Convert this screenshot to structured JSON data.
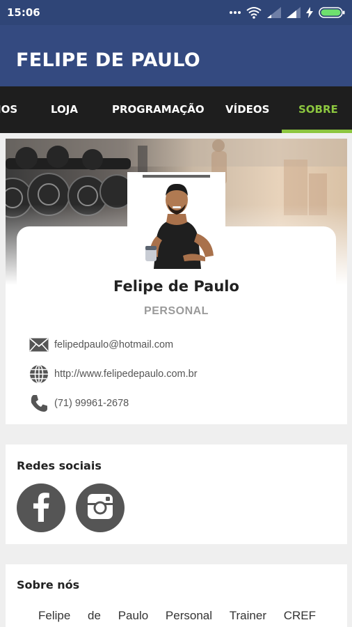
{
  "status_bar": {
    "time": "15:06",
    "icons": [
      "more-icon",
      "wifi-icon",
      "signal-icon",
      "signal-icon",
      "charging-icon",
      "battery-icon"
    ]
  },
  "app_bar": {
    "title": "FELIPE DE PAULO"
  },
  "tabs": [
    {
      "label": "IOS",
      "active": false
    },
    {
      "label": "LOJA",
      "active": false
    },
    {
      "label": "PROGRAMAÇÃO",
      "active": false
    },
    {
      "label": "VÍDEOS",
      "active": false
    },
    {
      "label": "SOBRE",
      "active": true
    }
  ],
  "profile": {
    "name": "Felipe de Paulo",
    "role": "PERSONAL",
    "contacts": [
      {
        "icon": "mail-icon",
        "text": "felipedpaulo@hotmail.com"
      },
      {
        "icon": "globe-icon",
        "text": "http://www.felipedepaulo.com.br"
      },
      {
        "icon": "phone-icon",
        "text": "(71) 99961-2678"
      }
    ]
  },
  "social": {
    "title": "Redes sociais",
    "links": [
      {
        "icon": "facebook-icon"
      },
      {
        "icon": "instagram-icon"
      }
    ]
  },
  "about": {
    "title": "Sobre nós",
    "words": [
      "Felipe",
      "de",
      "Paulo",
      "Personal",
      "Trainer",
      "CREF"
    ]
  },
  "colors": {
    "status_bar": "#2f4577",
    "app_bar": "#344a80",
    "tab_bar": "#1e1e1e",
    "accent": "#8cc63f",
    "background": "#efefef",
    "icon_gray": "#555555"
  }
}
